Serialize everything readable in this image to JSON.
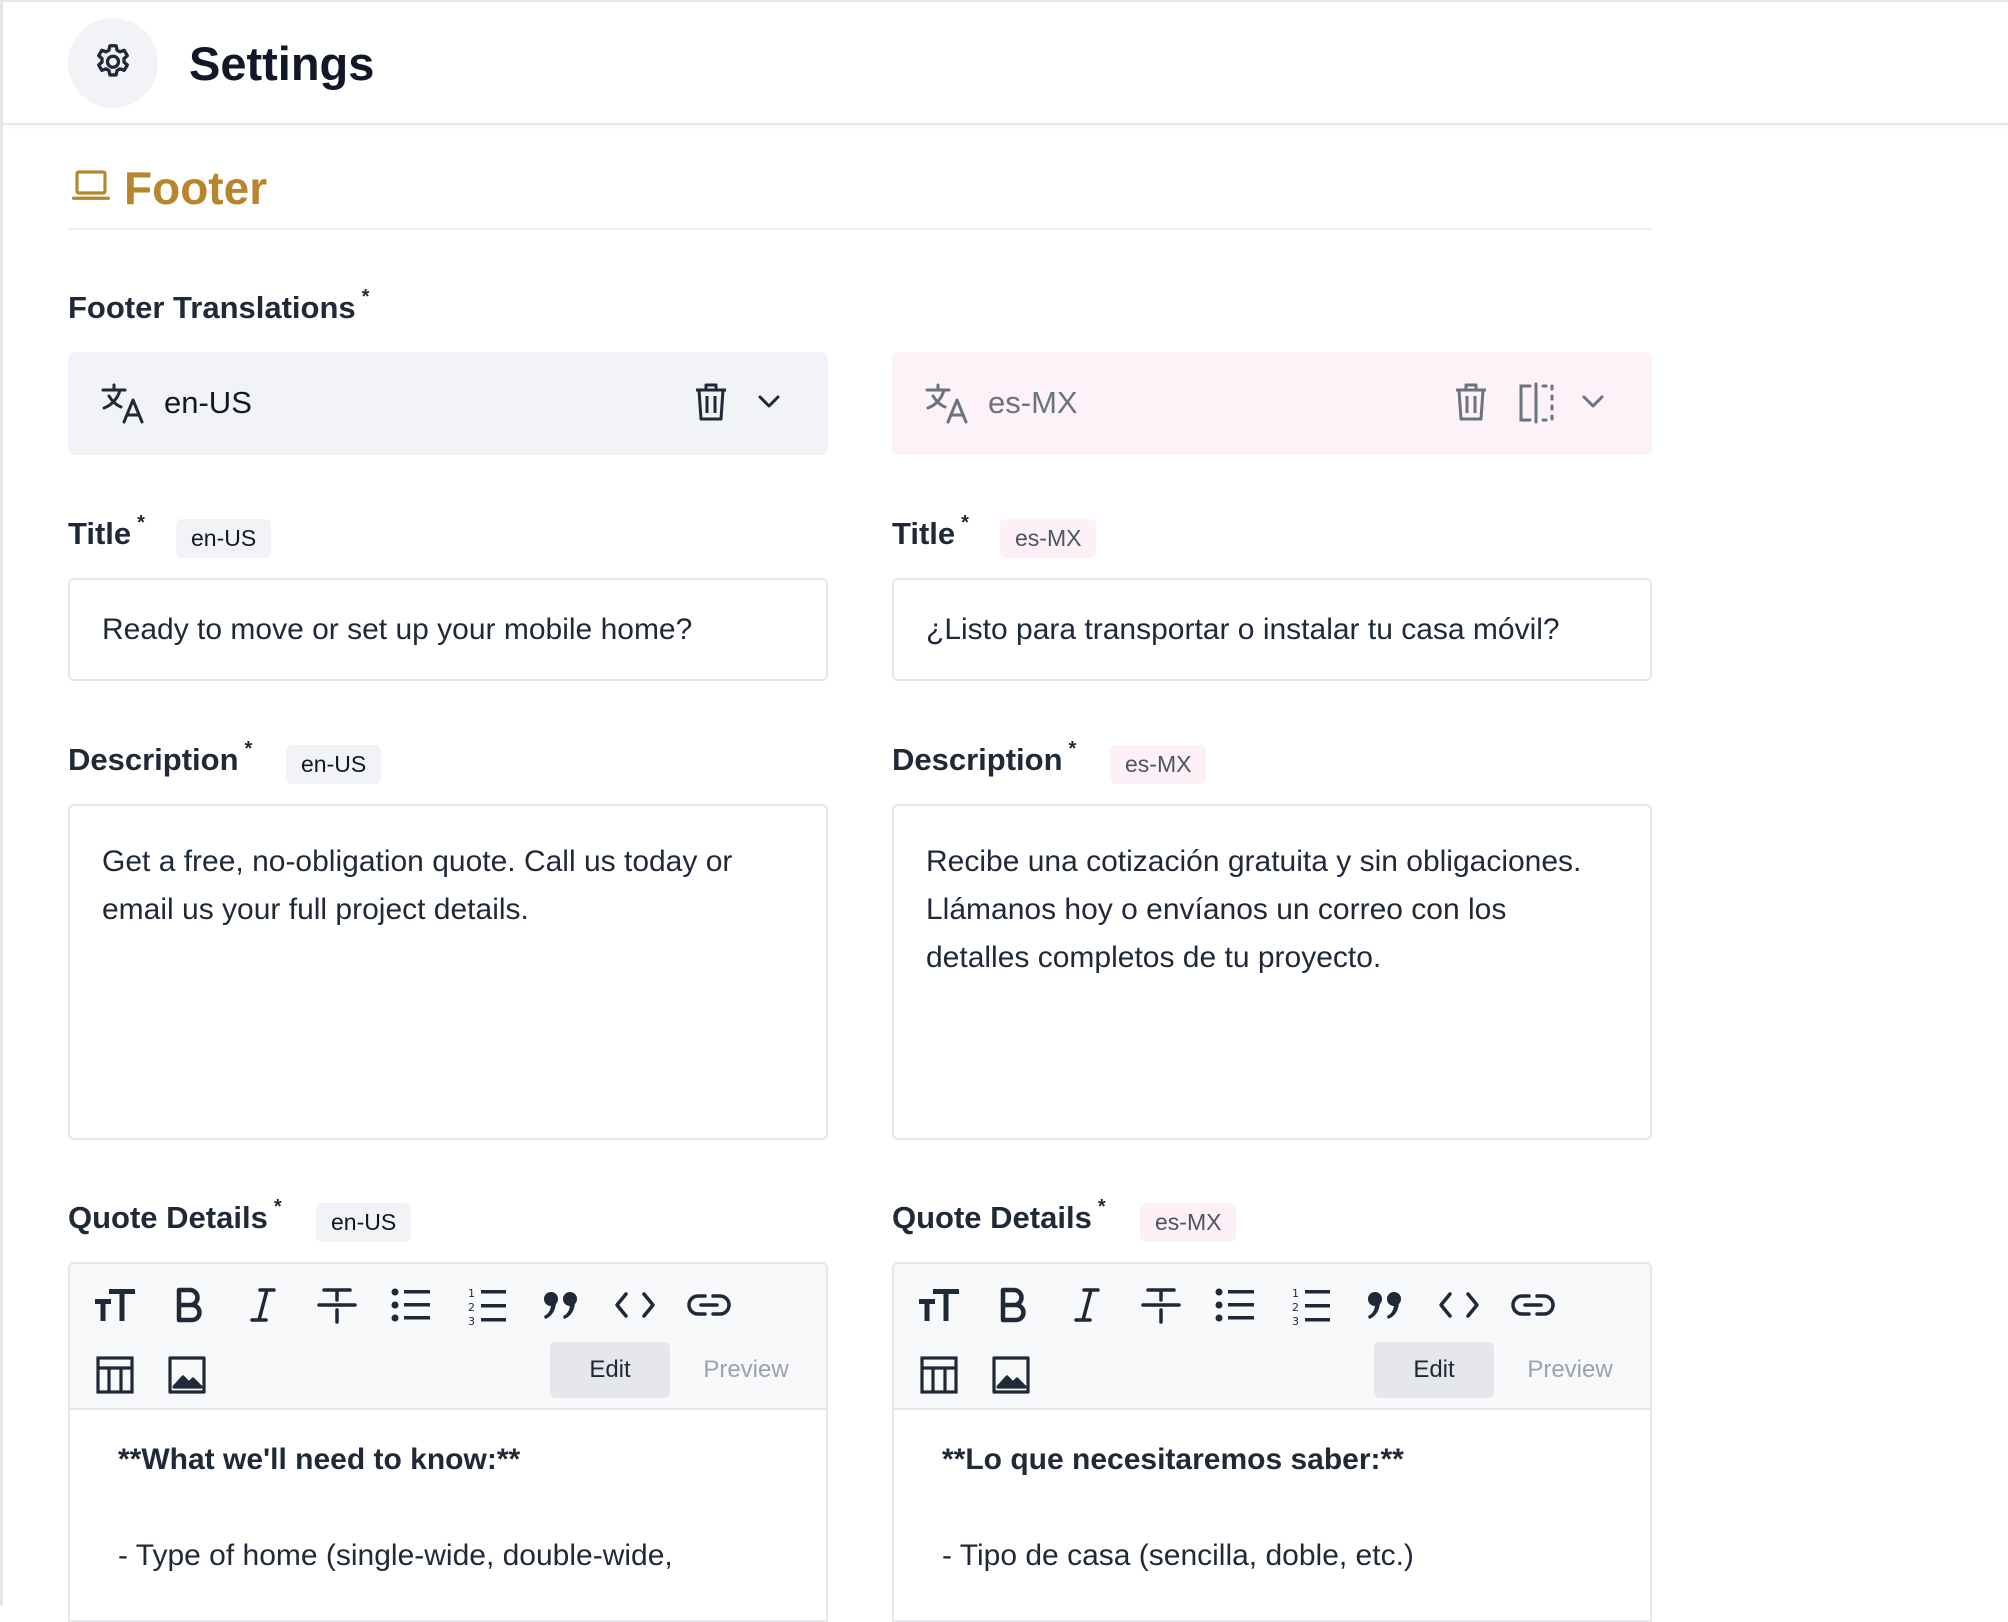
{
  "header": {
    "title": "Settings",
    "icon": "gear-icon"
  },
  "section": {
    "title": "Footer",
    "icon": "laptop-icon",
    "accent": "#b7862c"
  },
  "translations": {
    "label": "Footer Translations",
    "required": "*",
    "primary": {
      "locale": "en-US"
    },
    "secondary": {
      "locale": "es-MX"
    }
  },
  "fields": {
    "title": {
      "label": "Title",
      "required": "*",
      "en": {
        "tag": "en-US",
        "value": "Ready to move or set up your mobile home?"
      },
      "es": {
        "tag": "es-MX",
        "value": "¿Listo para transportar o instalar tu casa móvil?"
      }
    },
    "description": {
      "label": "Description",
      "required": "*",
      "en": {
        "tag": "en-US",
        "value": "Get a free, no-obligation quote. Call us today or email us your full project details."
      },
      "es": {
        "tag": "es-MX",
        "value": "Recibe una cotización gratuita y sin obligaciones. Llámanos hoy o envíanos un correo con los detalles completos de tu proyecto."
      }
    },
    "quote_details": {
      "label": "Quote Details",
      "required": "*",
      "edit_label": "Edit",
      "preview_label": "Preview",
      "en": {
        "tag": "en-US",
        "heading": "**What we'll need to know:**",
        "line1": "- Type of home (single-wide, double-wide,"
      },
      "es": {
        "tag": "es-MX",
        "heading": "**Lo que necesitaremos saber:**",
        "line1": "- Tipo de casa (sencilla, doble, etc.)"
      }
    }
  },
  "toolbar_icons": [
    "text-size-icon",
    "bold-icon",
    "italic-icon",
    "strikethrough-icon",
    "bulleted-list-icon",
    "numbered-list-icon",
    "quote-icon",
    "code-icon",
    "link-icon",
    "table-icon",
    "image-icon"
  ]
}
